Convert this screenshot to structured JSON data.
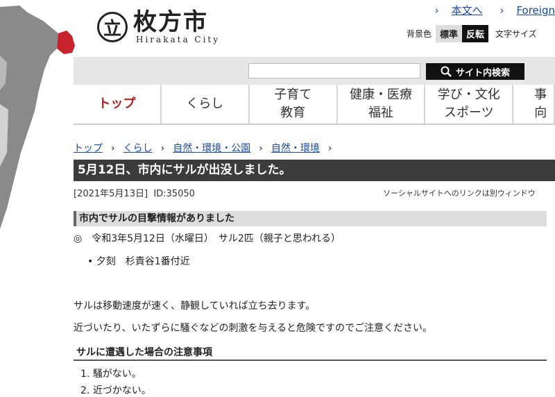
{
  "header": {
    "logo_emblem": "立",
    "logo_name": "枚方市",
    "logo_sub": "Hirakata City",
    "link_main": "本文へ",
    "link_foreign": "Foreign",
    "bg_label": "背景色",
    "btn_standard": "標準",
    "btn_reverse": "反転",
    "text_size_label": "文字サイズ"
  },
  "search": {
    "placeholder": "",
    "button_label": "サイト内検索"
  },
  "nav": {
    "items": [
      {
        "line1": "トップ",
        "line2": ""
      },
      {
        "line1": "くらし",
        "line2": ""
      },
      {
        "line1": "子育て",
        "line2": "教育"
      },
      {
        "line1": "健康・医療",
        "line2": "福祉"
      },
      {
        "line1": "学び・文化",
        "line2": "スポーツ"
      },
      {
        "line1": "事",
        "line2": "向"
      }
    ]
  },
  "breadcrumb": [
    "トップ",
    "くらし",
    "自然・環境・公園",
    "自然・環境"
  ],
  "page": {
    "title": "5月12日、市内にサルが出没しました。",
    "date": "[2021年5月13日]",
    "id": "ID:35050",
    "social_note": "ソーシャルサイトへのリンクは別ウィンドウ"
  },
  "content": {
    "section1_heading": "市内でサルの目撃情報がありました",
    "sighting": "◎　令和3年5月12日（水曜日）　サル2匹（親子と思われる）",
    "bullet": "夕刻　杉責谷1番付近",
    "para1": "サルは移動速度が速く、静観していれば立ち去ります。",
    "para2": "近づいたり、いたずらに騒ぐなどの刺激を与えると危険ですのでご注意ください。",
    "section2_heading": "サルに遭遇した場合の注意事項",
    "list": [
      "騒がない。",
      "近づかない。"
    ]
  },
  "colors": {
    "accent_red": "#b01f1f",
    "link": "#1a4aa0",
    "title_bg": "#3c3c3c"
  }
}
